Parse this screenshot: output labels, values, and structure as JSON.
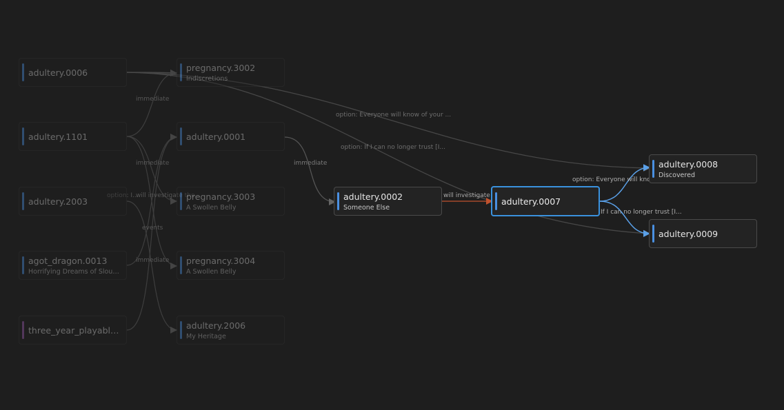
{
  "colors": {
    "background": "#1e1e1e",
    "node_bar_blue": "#4a90e2",
    "node_bar_purple": "#7a4c8a",
    "edge_active": "#5aa0e8",
    "edge_investigate": "#c0522e",
    "edge_dim": "#555555"
  },
  "nodes": {
    "n0006": {
      "title": "adultery.0006",
      "subtitle": ""
    },
    "n1101": {
      "title": "adultery.1101",
      "subtitle": ""
    },
    "n2003": {
      "title": "adultery.2003",
      "subtitle": ""
    },
    "ndragon": {
      "title": "agot_dragon.0013",
      "subtitle": "Horrifying Dreams of Sloug..."
    },
    "nthree": {
      "title": "three_year_playable_...",
      "subtitle": ""
    },
    "np3002": {
      "title": "pregnancy.3002",
      "subtitle": "Indiscretions"
    },
    "n0001": {
      "title": "adultery.0001",
      "subtitle": ""
    },
    "np3003": {
      "title": "pregnancy.3003",
      "subtitle": "A Swollen Belly"
    },
    "np3004": {
      "title": "pregnancy.3004",
      "subtitle": "A Swollen Belly"
    },
    "n2006": {
      "title": "adultery.2006",
      "subtitle": "My Heritage"
    },
    "n0002": {
      "title": "adultery.0002",
      "subtitle": "Someone Else"
    },
    "n0007": {
      "title": "adultery.0007",
      "subtitle": ""
    },
    "n0008": {
      "title": "adultery.0008",
      "subtitle": "Discovered"
    },
    "n0009": {
      "title": "adultery.0009",
      "subtitle": ""
    }
  },
  "edge_labels": {
    "imm1": "immediate",
    "imm2": "immediate",
    "opt_left": "option: I...",
    "inv_left": "will investigate the...",
    "events": "events",
    "imm3": "immediate",
    "imm_0001": "immediate",
    "investigate": "will investigate the",
    "opt_everyone_far": "option: Everyone will know of your ...",
    "opt_ican_far": "option: If I can no longer trust [I...",
    "opt_everyone": "option: Everyone will know",
    "opt_ican": "If I can no longer trust [I..."
  }
}
